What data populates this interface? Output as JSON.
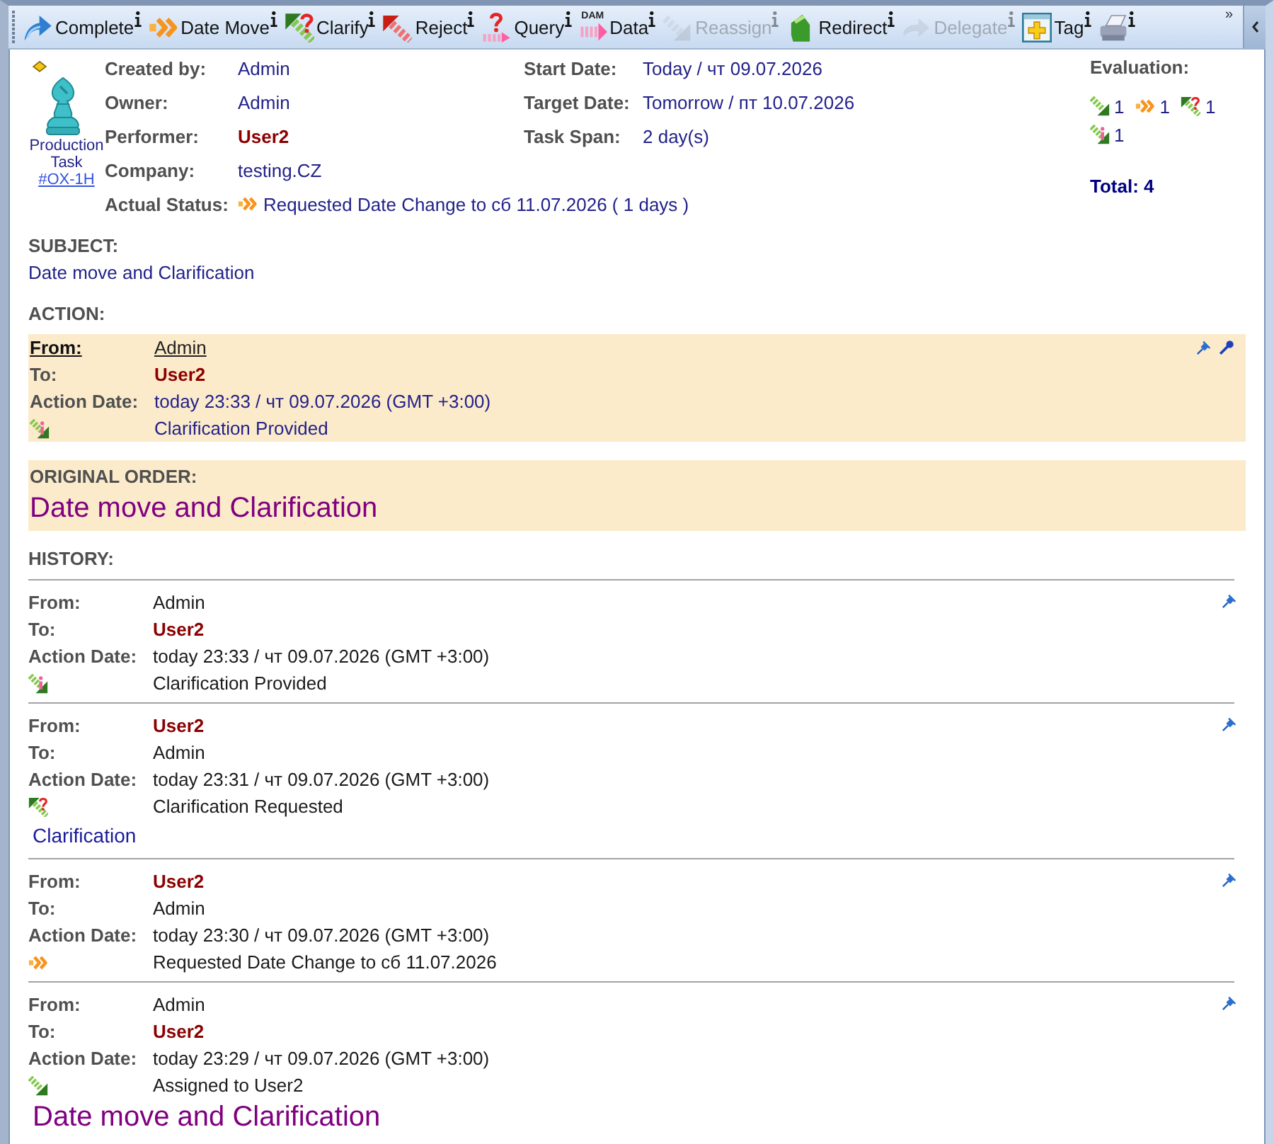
{
  "toolbar": {
    "items": [
      {
        "kind": "complete",
        "label": "Complete",
        "disabled": false
      },
      {
        "kind": "datemove",
        "label": "Date Move",
        "disabled": false
      },
      {
        "kind": "clarify",
        "label": "Clarify",
        "disabled": false
      },
      {
        "kind": "reject",
        "label": "Reject",
        "disabled": false
      },
      {
        "kind": "query",
        "label": "Query",
        "disabled": false
      },
      {
        "kind": "data",
        "label": "Data",
        "icon_caption": "DAM",
        "disabled": false
      },
      {
        "kind": "reassign",
        "label": "Reassign",
        "disabled": true
      },
      {
        "kind": "redirect",
        "label": "Redirect",
        "disabled": false
      },
      {
        "kind": "delegate",
        "label": "Delegate",
        "disabled": true
      },
      {
        "kind": "tag",
        "label": "Tag",
        "disabled": false
      },
      {
        "kind": "print",
        "disabled": false
      }
    ],
    "overflow": "»"
  },
  "task": {
    "type_label": "Production Task",
    "id_link": "#OX-1H",
    "left_fields": [
      {
        "label": "Created by:",
        "value": "Admin",
        "highlight": false
      },
      {
        "label": "Owner:",
        "value": "Admin",
        "highlight": false
      },
      {
        "label": "Performer:",
        "value": "User2",
        "highlight": true
      },
      {
        "label": "Company:",
        "value": "testing.CZ",
        "highlight": false
      }
    ],
    "status": {
      "label": "Actual Status:",
      "kind": "datemove",
      "value": "Requested Date Change to сб 11.07.2026 ( 1 days )"
    },
    "right_fields": [
      {
        "label": "Start Date:",
        "value": "Today / чт 09.07.2026"
      },
      {
        "label": "Target Date:",
        "value": "Tomorrow / пт 10.07.2026"
      },
      {
        "label": "Task Span:",
        "value": "2 day(s)"
      }
    ],
    "evaluation": {
      "label": "Evaluation:",
      "items": [
        {
          "kind": "assign",
          "count": "1"
        },
        {
          "kind": "datemove",
          "count": "1"
        },
        {
          "kind": "clarify",
          "count": "1"
        },
        {
          "kind": "provided",
          "count": "1"
        }
      ],
      "total": "Total: 4"
    }
  },
  "subject": {
    "label": "SUBJECT:",
    "text": "Date move and Clarification"
  },
  "action": {
    "label": "ACTION:",
    "rows": [
      {
        "label": "From:",
        "value": "Admin",
        "highlight": false,
        "link": true
      },
      {
        "label": "To:",
        "value": "User2",
        "highlight": true,
        "link": false
      },
      {
        "label": "Action Date:",
        "value": "today 23:33 / чт 09.07.2026 (GMT +3:00)",
        "highlight": false,
        "link": false
      }
    ],
    "kind": "provided",
    "result": "Clarification Provided"
  },
  "original_order": {
    "label": "ORIGINAL ORDER:",
    "text": "Date move and Clarification"
  },
  "history": {
    "label": "HISTORY:",
    "entries": [
      {
        "rows": [
          {
            "label": "From:",
            "value": "Admin",
            "highlight": false
          },
          {
            "label": "To:",
            "value": "User2",
            "highlight": true
          },
          {
            "label": "Action Date:",
            "value": "today 23:33 / чт 09.07.2026 (GMT +3:00)",
            "highlight": false
          }
        ],
        "kind": "provided",
        "result": "Clarification Provided"
      },
      {
        "rows": [
          {
            "label": "From:",
            "value": "User2",
            "highlight": true
          },
          {
            "label": "To:",
            "value": "Admin",
            "highlight": false
          },
          {
            "label": "Action Date:",
            "value": "today 23:31 / чт 09.07.2026 (GMT +3:00)",
            "highlight": false
          }
        ],
        "kind": "clarify",
        "result": "Clarification Requested",
        "message": {
          "kind": "note",
          "text": "Clarification"
        }
      },
      {
        "rows": [
          {
            "label": "From:",
            "value": "User2",
            "highlight": true
          },
          {
            "label": "To:",
            "value": "Admin",
            "highlight": false
          },
          {
            "label": "Action Date:",
            "value": "today 23:30 / чт 09.07.2026 (GMT +3:00)",
            "highlight": false
          }
        ],
        "kind": "datemove",
        "result": "Requested Date Change to сб 11.07.2026"
      },
      {
        "rows": [
          {
            "label": "From:",
            "value": "Admin",
            "highlight": false
          },
          {
            "label": "To:",
            "value": "User2",
            "highlight": true
          },
          {
            "label": "Action Date:",
            "value": "today 23:29 / чт 09.07.2026 (GMT +3:00)",
            "highlight": false
          }
        ],
        "kind": "assign",
        "result": "Assigned to User2",
        "message": {
          "kind": "order",
          "text": "Date move and Clarification"
        }
      }
    ]
  }
}
